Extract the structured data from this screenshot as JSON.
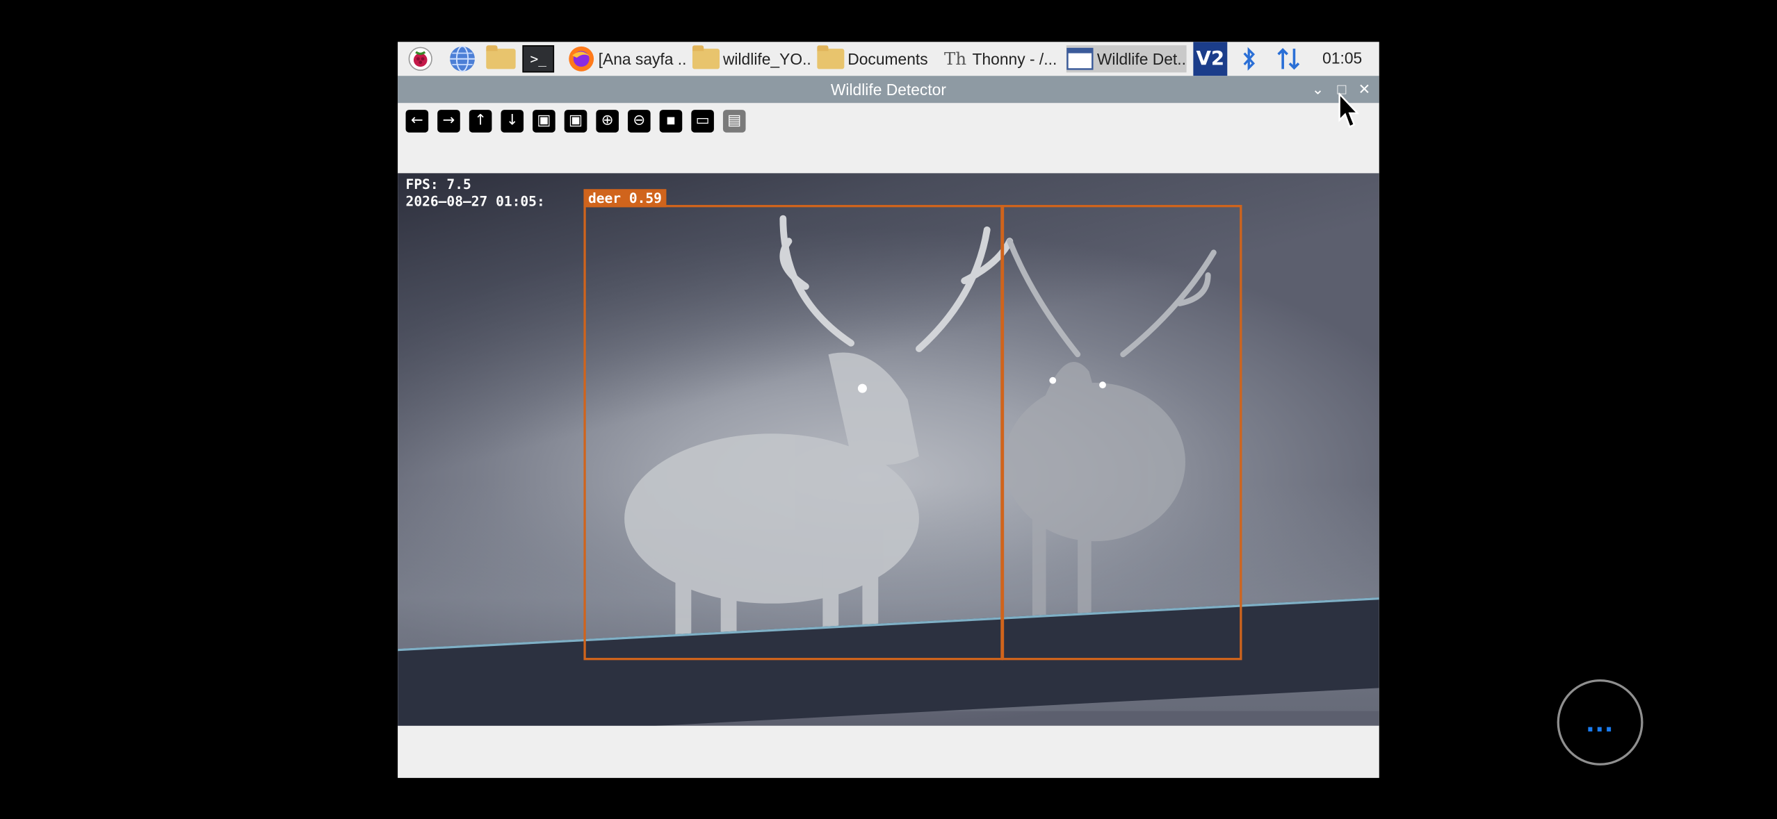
{
  "taskbar": {
    "apps": [
      {
        "icon": "raspberry-icon"
      },
      {
        "icon": "globe-icon"
      },
      {
        "icon": "files-icon"
      },
      {
        "icon": "terminal-icon"
      }
    ],
    "tasks": [
      {
        "label": "[Ana sayfa ...",
        "icon": "firefox-icon"
      },
      {
        "label": "wildlife_YO...",
        "icon": "folder-icon"
      },
      {
        "label": "Documents",
        "icon": "folder-icon"
      },
      {
        "label": "Thonny  -  /...",
        "icon": "thonny-icon"
      },
      {
        "label": "Wildlife Det...",
        "icon": "window-icon"
      }
    ],
    "tray": [
      {
        "icon": "vnc-icon",
        "text": "V2"
      },
      {
        "icon": "bluetooth-icon"
      },
      {
        "icon": "network-icon"
      }
    ],
    "clock": "01:05"
  },
  "window": {
    "title": "Wildlife Detector",
    "buttons": {
      "minimize": "⌄",
      "maximize": "□",
      "close": "✕"
    }
  },
  "toolbar": {
    "tools": [
      {
        "icon": "arrow-left-icon",
        "glyph": "←"
      },
      {
        "icon": "arrow-right-icon",
        "glyph": "→"
      },
      {
        "icon": "arrow-up-icon",
        "glyph": "↑"
      },
      {
        "icon": "arrow-down-icon",
        "glyph": "↓"
      },
      {
        "icon": "image-icon",
        "glyph": "▣"
      },
      {
        "icon": "image-edit-icon",
        "glyph": "▣"
      },
      {
        "icon": "zoom-in-icon",
        "glyph": "⊕"
      },
      {
        "icon": "zoom-out-icon",
        "glyph": "⊖"
      },
      {
        "icon": "save-icon",
        "glyph": "▪"
      },
      {
        "icon": "clipboard-icon",
        "glyph": "▭"
      },
      {
        "icon": "properties-icon",
        "glyph": "▤"
      }
    ]
  },
  "camera": {
    "fps_text": "FPS: 7.5",
    "timestamp_text": "2026—08—27 01:05:",
    "detection_label": "deer 0.59",
    "accent_color": "#d0641c"
  },
  "overlay": {
    "more_button": "..."
  }
}
